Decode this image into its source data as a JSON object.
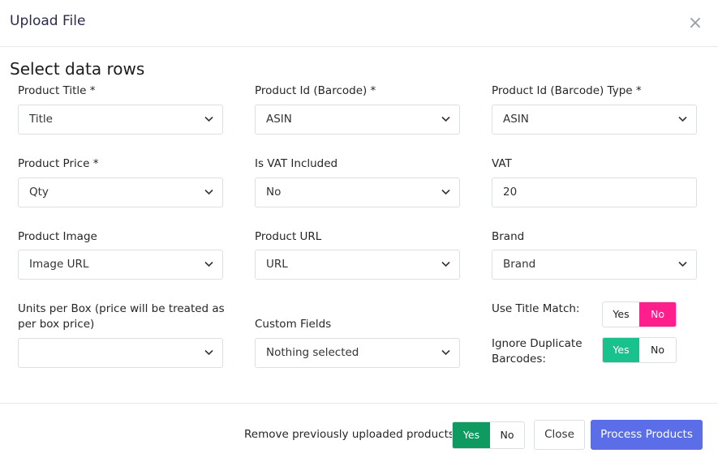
{
  "modal": {
    "title": "Upload File",
    "close_icon": "close-icon"
  },
  "section": {
    "title": "Select data rows"
  },
  "fields": {
    "product_title": {
      "label": "Product Title *",
      "value": "Title"
    },
    "product_id": {
      "label": "Product Id (Barcode) *",
      "value": "ASIN"
    },
    "product_id_type": {
      "label": "Product Id (Barcode) Type *",
      "value": "ASIN"
    },
    "product_price": {
      "label": "Product Price *",
      "value": "Qty"
    },
    "vat_included": {
      "label": "Is VAT Included",
      "value": "No"
    },
    "vat": {
      "label": "VAT",
      "value": "20"
    },
    "product_image": {
      "label": "Product Image",
      "value": "Image URL"
    },
    "product_url": {
      "label": "Product URL",
      "value": "URL"
    },
    "brand": {
      "label": "Brand",
      "value": "Brand"
    },
    "units_per_box": {
      "label_line1": "Units per Box (price will be treated as",
      "label_line2": "per box price)",
      "value": ""
    },
    "custom_fields": {
      "label": "Custom Fields",
      "value": "Nothing selected"
    }
  },
  "toggles": {
    "use_title_match": {
      "label": "Use Title Match:",
      "yes": "Yes",
      "no": "No",
      "selected": "No",
      "accent": "#ff1f8c"
    },
    "ignore_duplicates": {
      "label_line1": "Ignore Duplicate",
      "label_line2": "Barcodes:",
      "yes": "Yes",
      "no": "No",
      "selected": "Yes",
      "accent": "#19c28c"
    },
    "remove_previous": {
      "label": "Remove previously uploaded products:",
      "yes": "Yes",
      "no": "No",
      "selected": "Yes",
      "accent": "#0f9a61"
    }
  },
  "buttons": {
    "close": "Close",
    "process": "Process Products",
    "process_color": "#5b6ee8"
  }
}
